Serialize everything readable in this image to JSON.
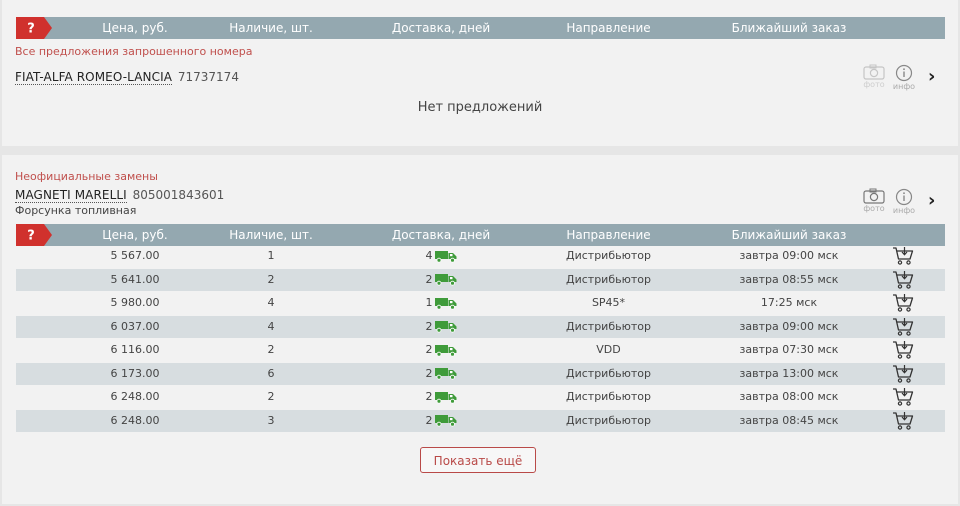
{
  "table_header": {
    "help_badge": "?",
    "price": "Цена, руб.",
    "stock": "Наличие, шт.",
    "delivery": "Доставка, дней",
    "direction": "Направление",
    "nearest_order": "Ближайший заказ"
  },
  "section1": {
    "note": "Все предложения запрошенного номера",
    "brand": "FIAT-ALFA ROMEO-LANCIA",
    "article": "71737174",
    "photo_label": "фото",
    "info_label": "инфо",
    "empty_text": "Нет предложений"
  },
  "section2": {
    "note": "Неофициальные замены",
    "brand": "MAGNETI MARELLI",
    "article": "805001843601",
    "description": "Форсунка топливная",
    "photo_label": "фото",
    "info_label": "инфо",
    "rows": [
      {
        "price": "5 567.00",
        "stock": "1",
        "delivery": "4",
        "direction": "Дистрибьютор",
        "order": "завтра 09:00 мск"
      },
      {
        "price": "5 641.00",
        "stock": "2",
        "delivery": "2",
        "direction": "Дистрибьютор",
        "order": "завтра 08:55 мск"
      },
      {
        "price": "5 980.00",
        "stock": "4",
        "delivery": "1",
        "direction": "SP45*",
        "order": "17:25 мск"
      },
      {
        "price": "6 037.00",
        "stock": "4",
        "delivery": "2",
        "direction": "Дистрибьютор",
        "order": "завтра 09:00 мск"
      },
      {
        "price": "6 116.00",
        "stock": "2",
        "delivery": "2",
        "direction": "VDD",
        "order": "завтра 07:30 мск"
      },
      {
        "price": "6 173.00",
        "stock": "6",
        "delivery": "2",
        "direction": "Дистрибьютор",
        "order": "завтра 13:00 мск"
      },
      {
        "price": "6 248.00",
        "stock": "2",
        "delivery": "2",
        "direction": "Дистрибьютор",
        "order": "завтра 08:00 мск"
      },
      {
        "price": "6 248.00",
        "stock": "3",
        "delivery": "2",
        "direction": "Дистрибьютор",
        "order": "завтра 08:45 мск"
      }
    ],
    "more_button": "Показать ещё"
  },
  "colors": {
    "header_bg": "#94a8b0",
    "badge_red": "#d0312d",
    "accent_red": "#c0504d",
    "truck_green": "#3f9b3a",
    "alt_row": "#d7dde0"
  },
  "icons": {
    "photo": "camera-icon",
    "info": "info-icon",
    "next": "chevron-right-icon",
    "delivery": "truck-icon",
    "cart": "add-to-cart-icon"
  }
}
